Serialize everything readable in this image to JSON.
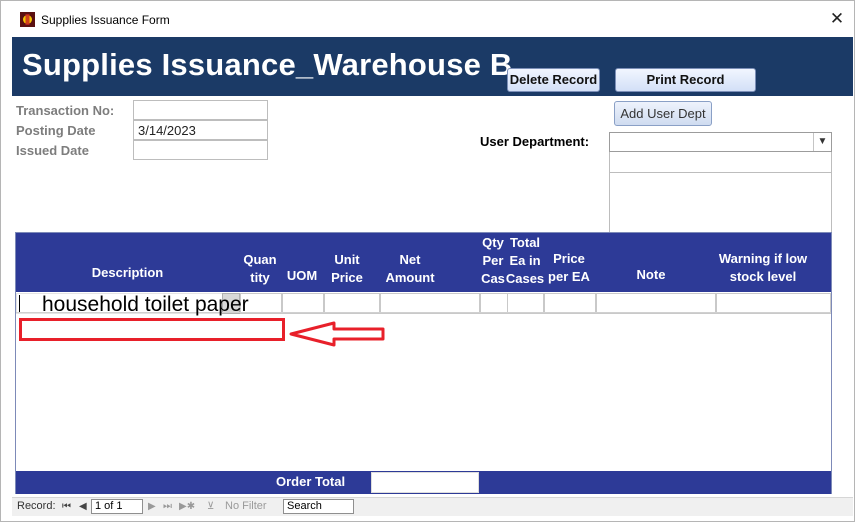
{
  "window": {
    "title": "Supplies Issuance Form",
    "close": "✕"
  },
  "header": {
    "title": "Supplies Issuance_Warehouse B",
    "delete_label": "Delete Record",
    "print_label": "Print Record"
  },
  "fields": {
    "transaction_no_label": "Transaction No:",
    "transaction_no_value": "",
    "posting_date_label": "Posting Date",
    "posting_date_value": "3/14/2023",
    "issued_date_label": "Issued Date",
    "issued_date_value": ""
  },
  "dept": {
    "add_label": "Add User Dept",
    "label": "User Department:",
    "value": ""
  },
  "grid": {
    "columns": {
      "description": "Description",
      "qty": [
        "Quan",
        "tity"
      ],
      "uom": "UOM",
      "unit_price": [
        "Unit",
        "Price"
      ],
      "net_amount": [
        "Net",
        "Amount"
      ],
      "qty_per_case": [
        "Qty",
        "Per",
        "Cas"
      ],
      "total_ea": [
        "Total",
        "Ea in",
        "Cases"
      ],
      "price_per_ea": [
        "Price",
        "per EA"
      ],
      "note": "Note",
      "warning": [
        "Warning if low",
        "stock level"
      ]
    },
    "row_description": "household toilet paper",
    "order_total_label": "Order Total",
    "order_total_value": ""
  },
  "nav": {
    "record_label": "Record:",
    "position": "1 of 1",
    "filter_label": "No Filter",
    "search_label": "Search"
  },
  "colors": {
    "header_bg": "#1b3a66",
    "grid_header_bg": "#2d3a97",
    "highlight": "#e8202a"
  },
  "icons": {
    "app": "app-icon",
    "close": "close-icon",
    "dropdown": "chevron-down-icon",
    "annotation": "arrow-left-icon"
  }
}
